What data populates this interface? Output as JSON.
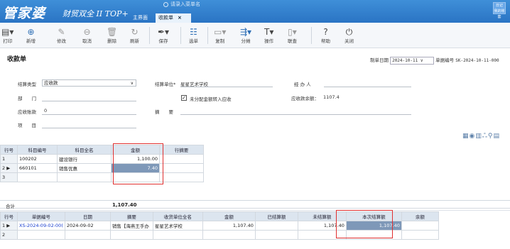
{
  "app": {
    "logo": "管家婆",
    "logo_sub": "财贸双全 II TOP+",
    "search_placeholder": "请录入菜单名",
    "user_line1": "日记",
    "user_line2": "我的账套"
  },
  "tabs": {
    "main": "主界面",
    "active": "收款单",
    "close": "×"
  },
  "toolbar": [
    {
      "label": "打印",
      "icon": "printer-icon"
    },
    {
      "label": "新增",
      "icon": "plus-circle-icon"
    },
    {
      "label": "修改",
      "icon": "edit-icon"
    },
    {
      "label": "取消",
      "icon": "minus-circle-icon"
    },
    {
      "label": "删除",
      "icon": "trash-icon"
    },
    {
      "label": "刷新",
      "icon": "refresh-icon"
    },
    {
      "label": "保存",
      "icon": "pen-icon"
    },
    {
      "label": "选单",
      "icon": "select-list-icon"
    },
    {
      "label": "复制",
      "icon": "copy-icon"
    },
    {
      "label": "分摊",
      "icon": "split-icon"
    },
    {
      "label": "操作",
      "icon": "operate-icon"
    },
    {
      "label": "联查",
      "icon": "linked-query-icon"
    },
    {
      "label": "帮助",
      "icon": "help-icon"
    },
    {
      "label": "关闭",
      "icon": "power-icon"
    }
  ],
  "form": {
    "title": "收款单",
    "date_label": "制单日期",
    "date_value": "2024-10-11",
    "docno_label": "单据编号",
    "docno_value": "SK-2024-10-11-000",
    "settle_type_label": "结算类型",
    "settle_type_value": "应收款",
    "dept_label": "部　　门",
    "ar_account_label": "应收账款",
    "ar_account_value": "0",
    "project_label": "项　　目",
    "settle_unit_label": "结算单位*",
    "settle_unit_value": "星星艺术学校",
    "checkbox_label": "未分配金额转入应收",
    "summary_label": "摘　　要",
    "handler_label": "经 办 人",
    "ar_balance_label": "应收款余额：",
    "ar_balance_value": "1107.4"
  },
  "table1": {
    "headers": [
      "行号",
      "科目编号",
      "科目全名",
      "金额",
      "行摘要"
    ],
    "rows": [
      {
        "n": "1",
        "code": "100202",
        "name": "建设银行",
        "amount": "1,100.00",
        "note": ""
      },
      {
        "n": "2",
        "code": "660101",
        "name": "销售优惠",
        "amount": "7.40",
        "note": ""
      },
      {
        "n": "3",
        "code": "",
        "name": "",
        "amount": "",
        "note": ""
      }
    ]
  },
  "sum": {
    "label": "合计",
    "value": "1,107.40"
  },
  "table2": {
    "headers": [
      "行号",
      "单据编号",
      "日期",
      "摘要",
      "收货单位全名",
      "金额",
      "已结算额",
      "未结算额",
      "本次结算额",
      "余额"
    ],
    "rows": [
      {
        "n": "1",
        "docno": "XS-2024-09-02-00(",
        "date": "2024-09-02",
        "summary": "销售【海燕王手办",
        "unit": "星星艺术学校",
        "amount": "1,107.40",
        "settled": "",
        "unsettled": "1,107.40",
        "current": "1,107.40",
        "balance": ""
      },
      {
        "n": "2",
        "docno": "",
        "date": "",
        "summary": "",
        "unit": "",
        "amount": "",
        "settled": "",
        "unsettled": "",
        "current": "",
        "balance": ""
      }
    ]
  }
}
